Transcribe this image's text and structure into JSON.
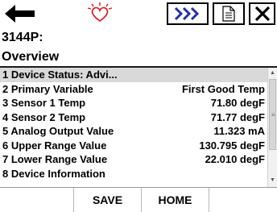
{
  "toolbar": {
    "back_icon": "back-arrow-icon",
    "alert_icon": "heart-alert-icon",
    "forward_icon": "fast-forward-icon",
    "document_icon": "document-icon",
    "close_icon": "close-icon",
    "alert_color": "#e0101a",
    "forward_color": "#2233aa"
  },
  "header": {
    "device_tag": "3144P:",
    "screen_title": "Overview"
  },
  "list": {
    "rows": [
      {
        "label": "1 Device Status: Advi...",
        "value": ""
      },
      {
        "label": "2 Primary Variable",
        "value": "First Good Temp"
      },
      {
        "label": "3 Sensor 1 Temp",
        "value": "71.80 degF"
      },
      {
        "label": "4 Sensor 2 Temp",
        "value": "71.77 degF"
      },
      {
        "label": "5 Analog Output Value",
        "value": "11.323 mA"
      },
      {
        "label": "6 Upper Range Value",
        "value": "130.795 degF"
      },
      {
        "label": "7 Lower Range Value",
        "value": "22.010 degF"
      },
      {
        "label": "8 Device Information",
        "value": ""
      }
    ]
  },
  "bottom_bar": {
    "save_label": "SAVE",
    "home_label": "HOME"
  }
}
